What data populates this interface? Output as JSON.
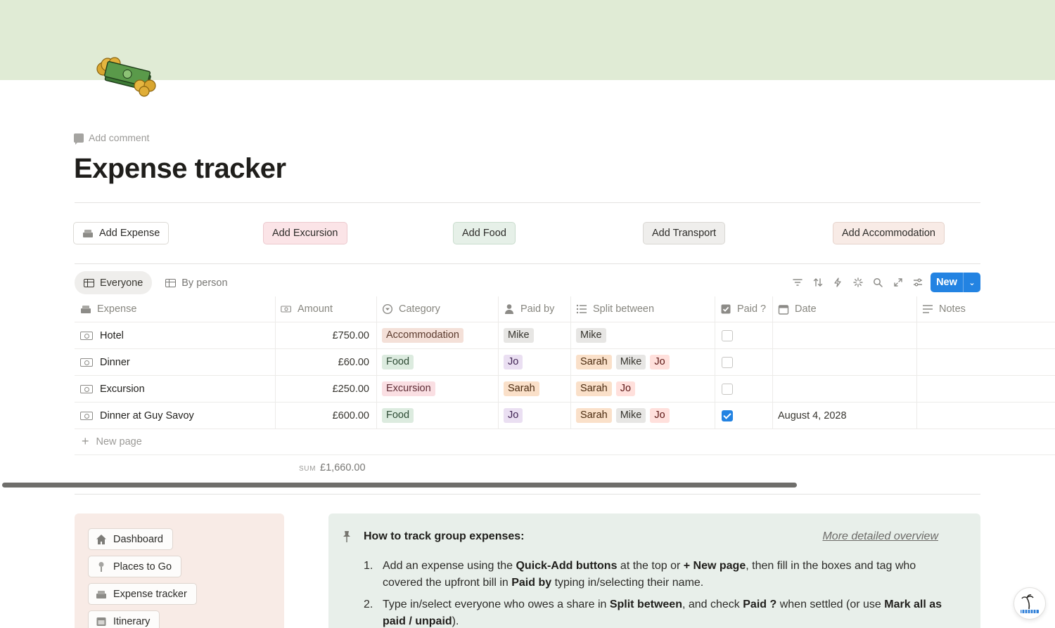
{
  "page": {
    "title": "Expense tracker",
    "add_comment": "Add comment"
  },
  "quick_add": [
    {
      "label": "Add Expense",
      "bg": "#ffffff",
      "border": "#dcdad5"
    },
    {
      "label": "Add Excursion",
      "bg": "#fbe4e7",
      "border": "#ecc9ce"
    },
    {
      "label": "Add Food",
      "bg": "#e6f0e8",
      "border": "#c9dccd"
    },
    {
      "label": "Add Transport",
      "bg": "#efeeec",
      "border": "#d9d7d3"
    },
    {
      "label": "Add Accommodation",
      "bg": "#f8ebe6",
      "border": "#e6d3cb"
    }
  ],
  "views": {
    "tabs": [
      {
        "label": "Everyone",
        "active": true
      },
      {
        "label": "By person",
        "active": false
      }
    ]
  },
  "toolbar": {
    "icons": [
      "filter-icon",
      "sort-icon",
      "automation-icon",
      "loading-icon",
      "search-icon",
      "expand-icon",
      "settings-icon"
    ],
    "new_label": "New"
  },
  "table": {
    "headers": {
      "expense": "Expense",
      "amount": "Amount",
      "category": "Category",
      "paid_by": "Paid by",
      "split_between": "Split between",
      "paid": "Paid ?",
      "date": "Date",
      "notes": "Notes"
    },
    "rows": [
      {
        "expense": "Hotel",
        "amount": "£750.00",
        "category": "Accommodation",
        "paid_by": "Mike",
        "split": [
          "Mike"
        ],
        "paid": false,
        "date": "",
        "notes": ""
      },
      {
        "expense": "Dinner",
        "amount": "£60.00",
        "category": "Food",
        "paid_by": "Jo",
        "split": [
          "Sarah",
          "Mike",
          "Jo"
        ],
        "paid": false,
        "date": "",
        "notes": ""
      },
      {
        "expense": "Excursion",
        "amount": "£250.00",
        "category": "Excursion",
        "paid_by": "Sarah",
        "split": [
          "Sarah",
          "Jo"
        ],
        "paid": false,
        "date": "",
        "notes": ""
      },
      {
        "expense": "Dinner at Guy Savoy",
        "amount": "£600.00",
        "category": "Food",
        "paid_by": "Jo",
        "split": [
          "Sarah",
          "Mike",
          "Jo"
        ],
        "paid": true,
        "date": "August 4, 2028",
        "notes": ""
      }
    ],
    "new_page": "New page",
    "sum_label": "SUM",
    "sum_value": "£1,660.00"
  },
  "tag_colors": {
    "Accommodation": {
      "bg": "#f4e0d8",
      "fg": "#5c3b2e"
    },
    "Food": {
      "bg": "#dcebdf",
      "fg": "#2e4b35"
    },
    "Excursion": {
      "bg": "#fadfe3",
      "fg": "#5e2c35"
    },
    "Mike": {
      "bg": "#e7e6e4",
      "fg": "#37352f"
    },
    "Jo": {
      "bg": "#ffe0dc",
      "fg": "#5d1715"
    },
    "Sarah": {
      "bg": "#fae0c9",
      "fg": "#49290e"
    },
    "JoPaid": {
      "bg": "#eadff2",
      "fg": "#412454"
    }
  },
  "nav": {
    "items": [
      {
        "label": "Dashboard",
        "icon": "home-icon"
      },
      {
        "label": "Places to Go",
        "icon": "pin-icon"
      },
      {
        "label": "Expense tracker",
        "icon": "money-icon"
      },
      {
        "label": "Itinerary",
        "icon": "calendar-icon"
      }
    ]
  },
  "info": {
    "title": "How to track group expenses:",
    "link": "More detailed overview",
    "steps": [
      {
        "num": "1.",
        "parts": [
          {
            "t": "Add an expense using the "
          },
          {
            "b": "Quick-Add buttons"
          },
          {
            "t": " at the top or "
          },
          {
            "b": "+ New page"
          },
          {
            "t": ", then fill in the boxes and tag who covered the upfront bill in "
          },
          {
            "b": "Paid by"
          },
          {
            "t": " typing in/selecting their name."
          }
        ]
      },
      {
        "num": "2.",
        "parts": [
          {
            "t": "Type in/select everyone who owes a share in "
          },
          {
            "b": "Split between"
          },
          {
            "t": ", and check "
          },
          {
            "b": "Paid ?"
          },
          {
            "t": " when settled (or use "
          },
          {
            "b": "Mark all as paid / unpaid"
          },
          {
            "t": ")."
          }
        ]
      }
    ]
  }
}
